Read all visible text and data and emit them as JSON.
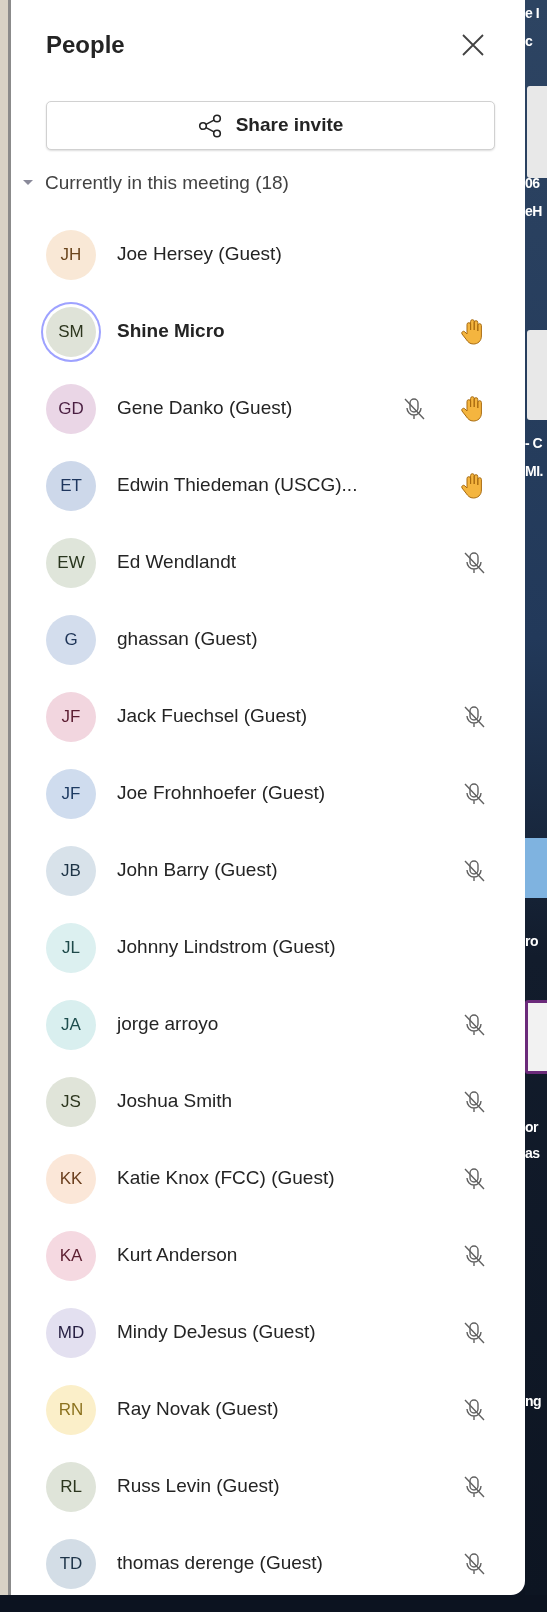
{
  "panel": {
    "title": "People",
    "share_button": "Share invite"
  },
  "section": {
    "label": "Currently in this meeting",
    "count": "(18)",
    "expanded": true
  },
  "participants": [
    {
      "initials": "JH",
      "name": "Joe Hersey (Guest)",
      "color": "#f9e8d6",
      "you": false,
      "speaking": false,
      "muted": false,
      "hand_raised": false
    },
    {
      "initials": "SM",
      "name": "Shine Micro",
      "color": "#dfe3d8",
      "you": true,
      "speaking": true,
      "muted": false,
      "hand_raised": true
    },
    {
      "initials": "GD",
      "name": "Gene Danko (Guest)",
      "color": "#ead6e6",
      "you": false,
      "speaking": false,
      "muted": true,
      "hand_raised": true
    },
    {
      "initials": "ET",
      "name": "Edwin Thiedeman (USCG)...",
      "color": "#cdd8ea",
      "you": false,
      "speaking": false,
      "muted": false,
      "hand_raised": true
    },
    {
      "initials": "EW",
      "name": "Ed Wendlandt",
      "color": "#dfe5da",
      "you": false,
      "speaking": false,
      "muted": true,
      "hand_raised": false
    },
    {
      "initials": "G",
      "name": "ghassan (Guest)",
      "color": "#d3dded",
      "you": false,
      "speaking": false,
      "muted": false,
      "hand_raised": false
    },
    {
      "initials": "JF",
      "name": "Jack Fuechsel (Guest)",
      "color": "#f2d6df",
      "you": false,
      "speaking": false,
      "muted": true,
      "hand_raised": false
    },
    {
      "initials": "JF",
      "name": "Joe Frohnhoefer (Guest)",
      "color": "#cfdcee",
      "you": false,
      "speaking": false,
      "muted": true,
      "hand_raised": false
    },
    {
      "initials": "JB",
      "name": "John Barry (Guest)",
      "color": "#d8e2ea",
      "you": false,
      "speaking": false,
      "muted": true,
      "hand_raised": false
    },
    {
      "initials": "JL",
      "name": "Johnny Lindstrom (Guest)",
      "color": "#dcf0f0",
      "you": false,
      "speaking": false,
      "muted": false,
      "hand_raised": false
    },
    {
      "initials": "JA",
      "name": "jorge arroyo",
      "color": "#d9efef",
      "you": false,
      "speaking": false,
      "muted": true,
      "hand_raised": false
    },
    {
      "initials": "JS",
      "name": "Joshua Smith",
      "color": "#e0e4d9",
      "you": false,
      "speaking": false,
      "muted": true,
      "hand_raised": false
    },
    {
      "initials": "KK",
      "name": "Katie Knox (FCC) (Guest)",
      "color": "#fbe7d8",
      "you": false,
      "speaking": false,
      "muted": true,
      "hand_raised": false
    },
    {
      "initials": "KA",
      "name": "Kurt Anderson",
      "color": "#f5d9e1",
      "you": false,
      "speaking": false,
      "muted": true,
      "hand_raised": false
    },
    {
      "initials": "MD",
      "name": "Mindy DeJesus (Guest)",
      "color": "#e3e0f0",
      "you": false,
      "speaking": false,
      "muted": true,
      "hand_raised": false
    },
    {
      "initials": "RN",
      "name": "Ray Novak (Guest)",
      "color": "#fbefc9",
      "you": false,
      "speaking": false,
      "muted": true,
      "hand_raised": false
    },
    {
      "initials": "RL",
      "name": "Russ Levin (Guest)",
      "color": "#dfe4d9",
      "you": false,
      "speaking": false,
      "muted": true,
      "hand_raised": false
    },
    {
      "initials": "TD",
      "name": "thomas derenge (Guest)",
      "color": "#d3dde6",
      "you": false,
      "speaking": false,
      "muted": true,
      "hand_raised": false
    }
  ],
  "desktop_fragments": [
    "e I",
    "c",
    "06",
    "eH",
    "- C",
    "MI.",
    "ro",
    "or",
    "as",
    "ng"
  ]
}
